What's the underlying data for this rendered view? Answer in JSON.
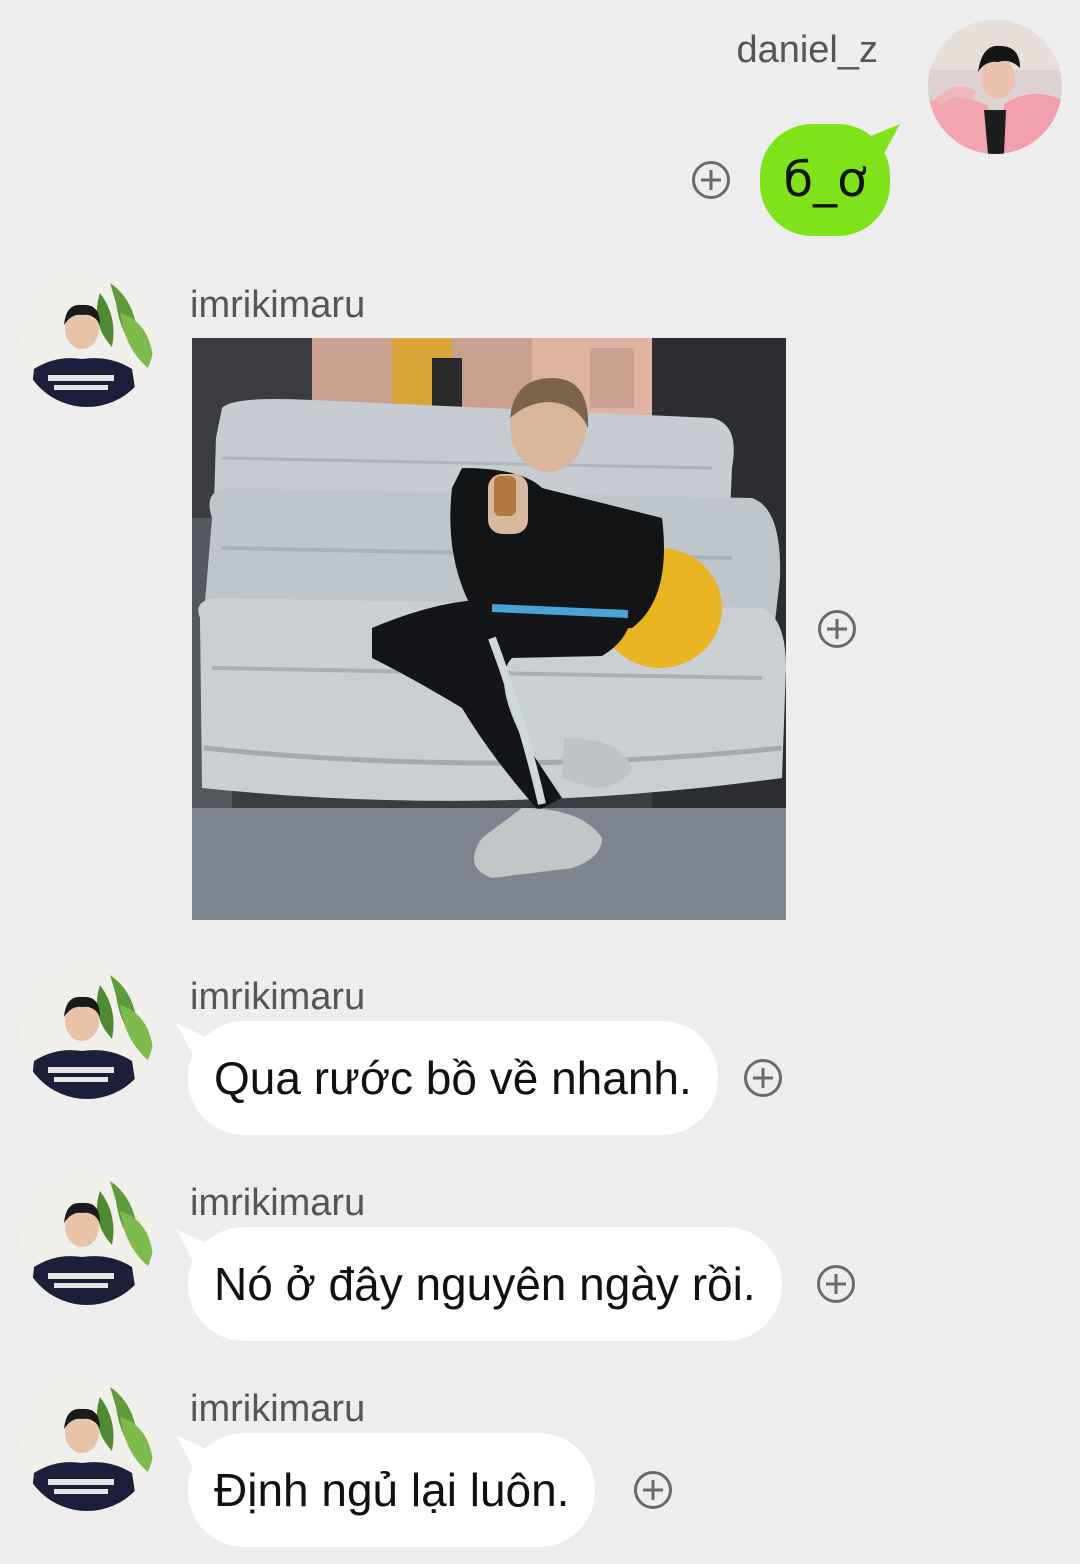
{
  "contact_me": {
    "username": "daniel_z",
    "avatar_desc": "profile photo"
  },
  "contact_other": {
    "username": "imrikimaru"
  },
  "messages": [
    {
      "sender": "daniel_z",
      "type": "emoticon",
      "text": "б_ơ"
    },
    {
      "sender": "imrikimaru",
      "type": "photo"
    },
    {
      "sender": "imrikimaru",
      "type": "text",
      "text": "Qua rước bồ về nhanh."
    },
    {
      "sender": "imrikimaru",
      "type": "text",
      "text": "Nó ở đây nguyên ngày rồi."
    },
    {
      "sender": "imrikimaru",
      "type": "text",
      "text": "Định ngủ lại luôn."
    }
  ],
  "icons": {
    "add": "plus-circle-icon"
  },
  "colors": {
    "background": "#ededed",
    "sent_bubble": "#7ee319",
    "received_bubble": "#ffffff",
    "username_text": "#555555",
    "icon_gray": "#6a6a6a"
  }
}
